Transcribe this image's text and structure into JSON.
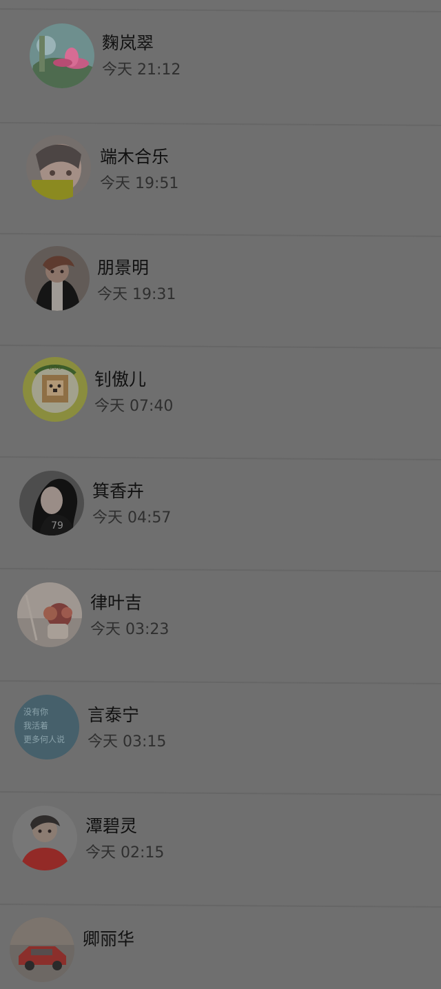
{
  "contacts": [
    {
      "name": "麴岚翠",
      "time": "今天 21:12",
      "avatar": "lotus-flower-avatar"
    },
    {
      "name": "端木合乐",
      "time": "今天 19:51",
      "avatar": "girl-selfie-avatar"
    },
    {
      "name": "朋景明",
      "time": "今天 19:31",
      "avatar": "young-man-avatar"
    },
    {
      "name": "钊傲儿",
      "time": "今天 07:40",
      "avatar": "cartoon-dog-avatar"
    },
    {
      "name": "箕香卉",
      "time": "今天 04:57",
      "avatar": "dark-hair-girl-avatar"
    },
    {
      "name": "律叶吉",
      "time": "今天 03:23",
      "avatar": "flowers-vase-avatar"
    },
    {
      "name": "言泰宁",
      "time": "今天 03:15",
      "avatar": "text-card-avatar"
    },
    {
      "name": "潭碧灵",
      "time": "今天 02:15",
      "avatar": "boy-red-shirt-avatar"
    },
    {
      "name": "卿丽华",
      "time": "",
      "avatar": "red-car-avatar"
    }
  ],
  "avatar_text": "没有你\n我活着\n更多何人说",
  "colors": {
    "overlay_background": "#6f6f6f",
    "name_text": "#111111",
    "time_text": "#2f2f2f"
  }
}
